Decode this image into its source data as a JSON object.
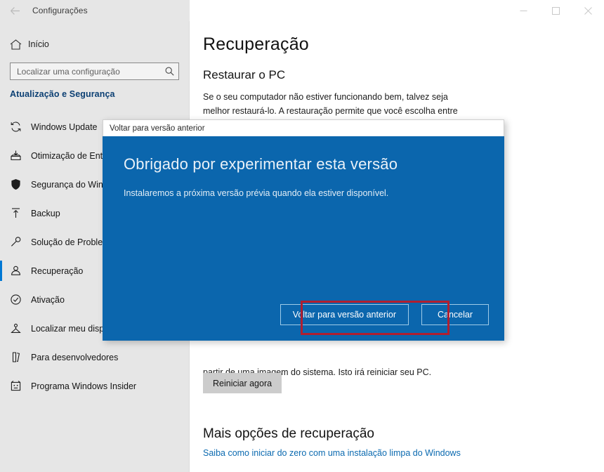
{
  "window": {
    "title": "Configurações",
    "back_icon": "back-arrow-icon",
    "minimize_label": "—",
    "maximize_label": "▢",
    "close_label": "✕"
  },
  "sidebar": {
    "home": {
      "label": "Início",
      "icon": "home-icon"
    },
    "search": {
      "placeholder": "Localizar uma configuração",
      "icon": "search-icon"
    },
    "section_title": "Atualização e Segurança",
    "items": [
      {
        "label": "Windows Update",
        "icon": "sync-icon",
        "selected": false
      },
      {
        "label": "Otimização de Entre",
        "icon": "delivery-optimization-icon",
        "selected": false
      },
      {
        "label": "Segurança do Winde",
        "icon": "shield-icon",
        "selected": false
      },
      {
        "label": "Backup",
        "icon": "backup-upload-icon",
        "selected": false
      },
      {
        "label": "Solução de Problem",
        "icon": "wrench-icon",
        "selected": false
      },
      {
        "label": "Recuperação",
        "icon": "recovery-icon",
        "selected": true
      },
      {
        "label": "Ativação",
        "icon": "check-circle-icon",
        "selected": false
      },
      {
        "label": "Localizar meu dispo",
        "icon": "find-device-icon",
        "selected": false
      },
      {
        "label": "Para desenvolvedores",
        "icon": "developer-icon",
        "selected": false
      },
      {
        "label": "Programa Windows Insider",
        "icon": "insider-icon",
        "selected": false
      }
    ]
  },
  "main": {
    "page_title": "Recuperação",
    "reset_heading": "Restaurar o PC",
    "reset_text": "Se o seu computador não estiver funcionando bem, talvez seja melhor restaurá-lo. A restauração permite que você escolha entre manter ou remover os arquivos pessoais e, em seguida, reinstala o Windows.",
    "advanced_text": "partir de uma imagem do sistema. Isto irá reiniciar seu PC.",
    "restart_button": "Reiniciar agora",
    "more_options_heading": "Mais opções de recuperação",
    "more_options_link": "Saiba como iniciar do zero com uma instalação limpa do Windows"
  },
  "dialog": {
    "titlebar": "Voltar para versão anterior",
    "heading": "Obrigado por experimentar esta versão",
    "body": "Instalaremos a próxima versão prévia quando ela estiver disponível.",
    "primary_button": "Voltar para versão anterior",
    "secondary_button": "Cancelar",
    "background_color": "#0b66ad",
    "highlight_color": "#b01f30"
  }
}
